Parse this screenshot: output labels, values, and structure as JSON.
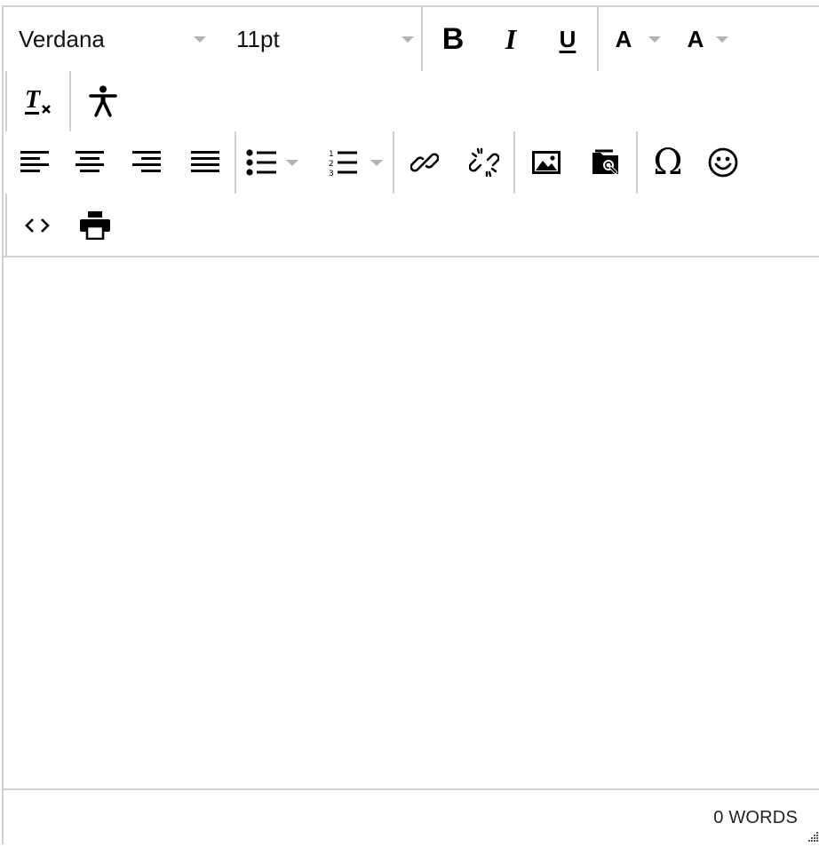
{
  "toolbar": {
    "font_family": "Verdana",
    "font_size": "11pt",
    "bold_label": "B",
    "italic_label": "I",
    "underline_label": "U",
    "text_color_label": "A",
    "bg_color_label": "A",
    "clear_format_label": "T",
    "special_char_label": "Ω"
  },
  "icons": {
    "bold": "bold-icon",
    "italic": "italic-icon",
    "underline": "underline-icon",
    "text_color": "text-color-icon",
    "background_color": "background-color-icon",
    "clear_formatting": "clear-formatting-icon",
    "accessibility": "accessibility-icon",
    "align_left": "align-left-icon",
    "align_center": "align-center-icon",
    "align_right": "align-right-icon",
    "align_justify": "align-justify-icon",
    "bullet_list": "bullet-list-icon",
    "numbered_list": "numbered-list-icon",
    "link": "link-icon",
    "unlink": "unlink-icon",
    "image": "image-icon",
    "browse_files": "browse-files-icon",
    "special_character": "special-character-icon",
    "emoji": "emoji-icon",
    "source_code": "source-code-icon",
    "print": "print-icon"
  },
  "status": {
    "word_count": "0 WORDS"
  },
  "colors": {
    "border": "#d0d0d0",
    "caret": "#b3b3b3",
    "icon": "#000000"
  }
}
